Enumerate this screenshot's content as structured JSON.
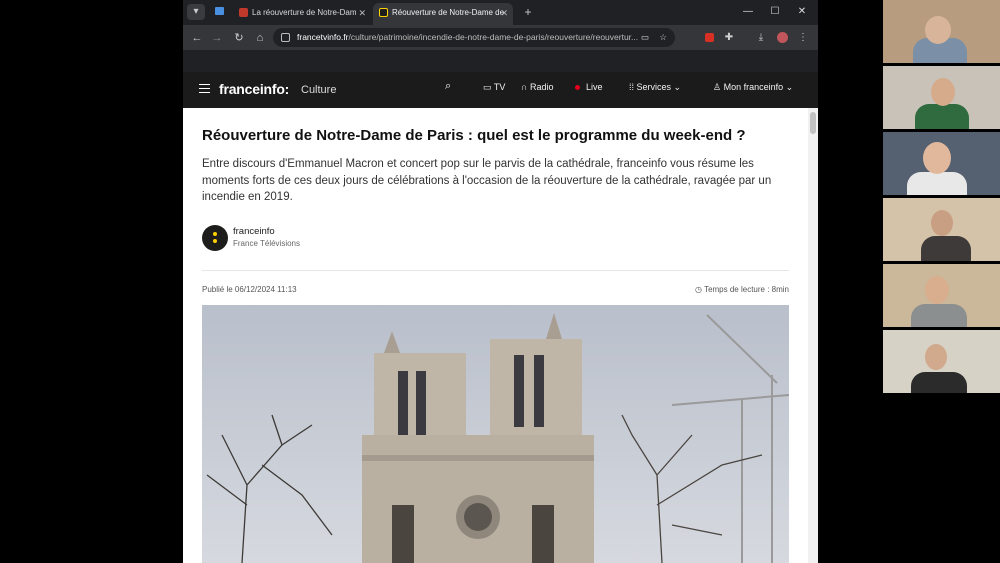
{
  "browser": {
    "tabs": [
      {
        "title": "La réouverture de Notre-Dam"
      },
      {
        "title": "Réouverture de Notre-Dame de"
      }
    ],
    "url_host": "francetvinfo.fr",
    "url_path": "/culture/patrimoine/incendie-de-notre-dame-de-paris/reouverture/reouvertur..."
  },
  "site": {
    "logo": "franceinfo:",
    "section": "Culture",
    "nav": {
      "tv": "TV",
      "radio": "Radio",
      "live": "Live",
      "services": "Services",
      "account": "Mon franceinfo"
    }
  },
  "article": {
    "title": "Réouverture de Notre-Dame de Paris : quel est le programme du week-end ?",
    "chapo": "Entre discours d'Emmanuel Macron et concert pop sur le parvis de la cathédrale, franceinfo vous résume les moments forts de ces deux jours de célébrations à l'occasion de la réouverture de la cathédrale, ravagée par un incendie en 2019.",
    "author": "franceinfo",
    "author_org": "France Télévisions",
    "published": "Publié le 06/12/2024 11:13",
    "read_time": "Temps de lecture : 8min"
  },
  "colors": {
    "site_header": "#1b1b1b",
    "live_red": "#e2001a",
    "logo_yellow": "#ffd200"
  }
}
